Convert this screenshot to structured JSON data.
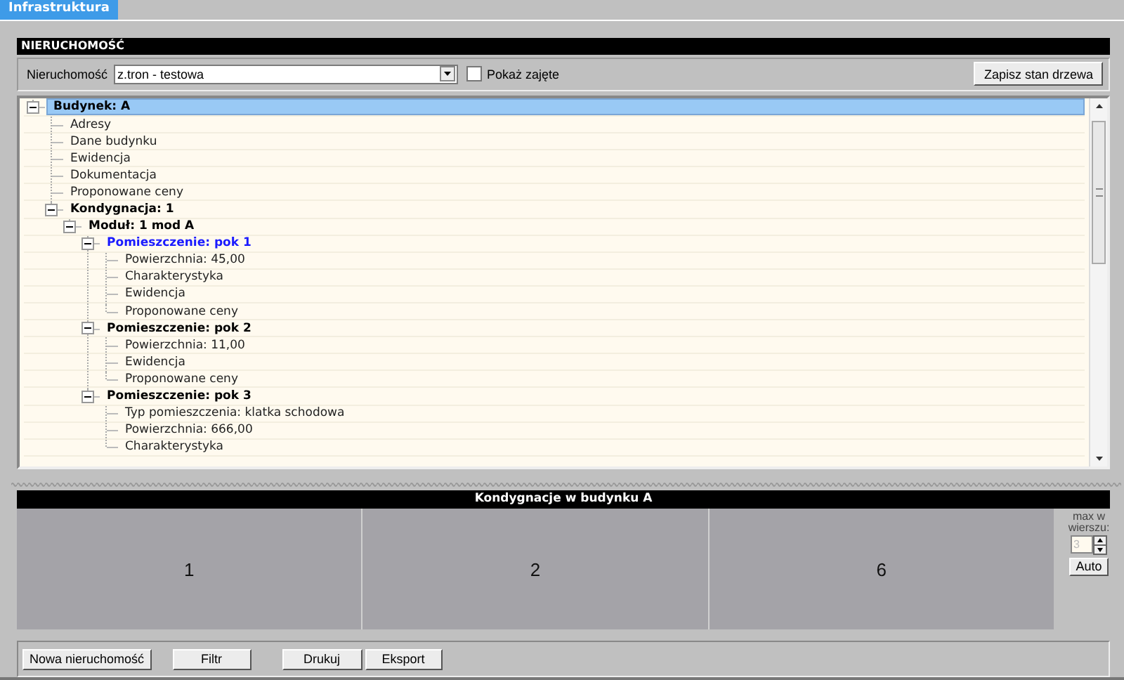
{
  "tabs": [
    {
      "label": "Infrastruktura",
      "selected": true
    }
  ],
  "panel": {
    "title": "NIERUCHOMOŚĆ"
  },
  "toolbar": {
    "property_label": "Nieruchomość",
    "property_value": "z.tron - testowa",
    "show_taken": {
      "label": "Pokaż zajęte",
      "checked": false
    },
    "save_button": "Zapisz stan drzewa"
  },
  "tree": [
    {
      "label": "Budynek: A",
      "expanded": true,
      "selected": true,
      "active": false,
      "children": [
        {
          "label": "Adresy",
          "selected": false,
          "active": false
        },
        {
          "label": "Dane budynku",
          "selected": false,
          "active": false
        },
        {
          "label": "Ewidencja",
          "selected": false,
          "active": false
        },
        {
          "label": "Dokumentacja",
          "selected": false,
          "active": false
        },
        {
          "label": "Proponowane ceny",
          "selected": false,
          "active": false
        },
        {
          "label": "Kondygnacja: 1",
          "expanded": true,
          "selected": false,
          "active": false,
          "children": [
            {
              "label": "Moduł: 1 mod A",
              "expanded": true,
              "selected": false,
              "active": false,
              "children": [
                {
                  "label": "Pomieszczenie: pok 1",
                  "expanded": true,
                  "selected": false,
                  "active": true,
                  "children": [
                    {
                      "label": "Powierzchnia: 45,00",
                      "selected": false,
                      "active": false
                    },
                    {
                      "label": "Charakterystyka",
                      "selected": false,
                      "active": false
                    },
                    {
                      "label": "Ewidencja",
                      "selected": false,
                      "active": false
                    },
                    {
                      "label": "Proponowane ceny",
                      "selected": false,
                      "active": false
                    }
                  ]
                },
                {
                  "label": "Pomieszczenie: pok 2",
                  "expanded": true,
                  "selected": false,
                  "active": false,
                  "children": [
                    {
                      "label": "Powierzchnia: 11,00",
                      "selected": false,
                      "active": false
                    },
                    {
                      "label": "Ewidencja",
                      "selected": false,
                      "active": false
                    },
                    {
                      "label": "Proponowane ceny",
                      "selected": false,
                      "active": false
                    }
                  ]
                },
                {
                  "label": "Pomieszczenie: pok 3",
                  "expanded": true,
                  "selected": false,
                  "active": false,
                  "children": [
                    {
                      "label": "Typ pomieszczenia: klatka schodowa",
                      "selected": false,
                      "active": false
                    },
                    {
                      "label": "Powierzchnia: 666,00",
                      "selected": false,
                      "active": false
                    },
                    {
                      "label": "Charakterystyka",
                      "selected": false,
                      "active": false
                    }
                  ]
                }
              ]
            }
          ]
        }
      ]
    }
  ],
  "floors": {
    "title": "Kondygnacje w budynku A",
    "cells": [
      "1",
      "2",
      "6"
    ],
    "max_per_row": {
      "label": "max w wierszu:",
      "value": "3",
      "disabled": true
    },
    "auto_button": "Auto"
  },
  "buttons": [
    "Nowa nieruchomość",
    "Filtr",
    "Drukuj",
    "Eksport"
  ]
}
